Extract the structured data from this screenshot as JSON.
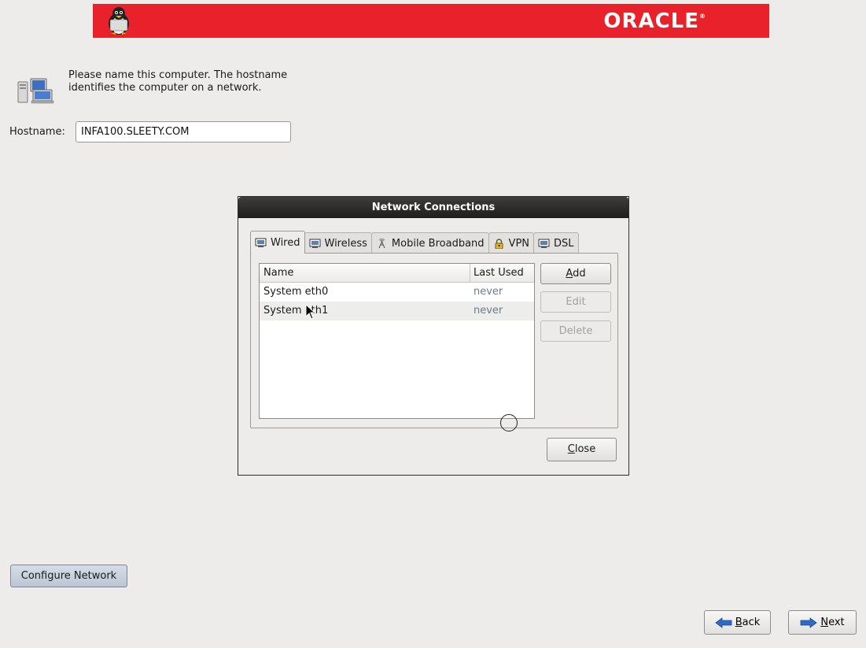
{
  "banner": {
    "brand": "ORACLE",
    "trademark": "®"
  },
  "intro": {
    "description": "Please name this computer.  The hostname identifies the computer on a network."
  },
  "hostname": {
    "label": "Hostname:",
    "value": "INFA100.SLEETY.COM"
  },
  "dialog": {
    "title": "Network Connections",
    "tabs": [
      {
        "label": "Wired",
        "icon": "network-card-icon",
        "active": true
      },
      {
        "label": "Wireless",
        "icon": "network-card-icon",
        "active": false
      },
      {
        "label": "Mobile Broadband",
        "icon": "antenna-icon",
        "active": false
      },
      {
        "label": "VPN",
        "icon": "lock-icon",
        "active": false
      },
      {
        "label": "DSL",
        "icon": "network-card-icon",
        "active": false
      }
    ],
    "columns": {
      "name": "Name",
      "last_used": "Last Used"
    },
    "rows": [
      {
        "name": "System eth0",
        "last_used": "never"
      },
      {
        "name": "System eth1",
        "last_used": "never"
      }
    ],
    "buttons": {
      "add": {
        "mnemonic": "A",
        "rest": "dd"
      },
      "edit": "Edit",
      "delete": "Delete",
      "close": {
        "mnemonic": "C",
        "rest": "lose"
      }
    }
  },
  "configure_network": "Configure Network",
  "nav": {
    "back": {
      "mnemonic": "B",
      "rest": "ack"
    },
    "next": {
      "mnemonic": "N",
      "rest": "ext"
    }
  }
}
